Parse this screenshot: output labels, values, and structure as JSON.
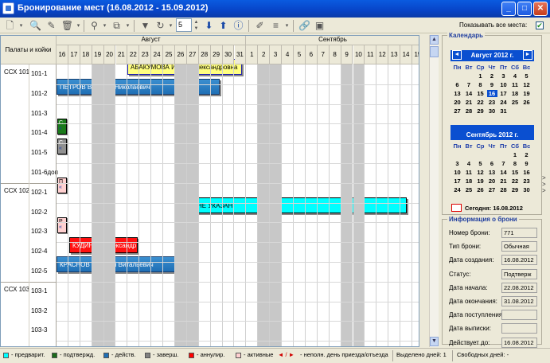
{
  "window": {
    "title": "Бронирование мест (16.08.2012 - 15.09.2012)"
  },
  "toolbar": {
    "spin_value": "5",
    "show_all_label": "Показывать все места:",
    "show_all_checked": true
  },
  "grid": {
    "header_left": "Палаты и койки",
    "months": [
      "Август",
      "Сентябрь"
    ],
    "days": [
      "16",
      "17",
      "18",
      "19",
      "20",
      "21",
      "22",
      "23",
      "24",
      "25",
      "26",
      "27",
      "28",
      "29",
      "30",
      "31",
      "1",
      "2",
      "3",
      "4",
      "5",
      "6",
      "7",
      "8",
      "9",
      "10",
      "11",
      "12",
      "13",
      "14",
      "15"
    ],
    "rooms": [
      {
        "name": "ССХ 101",
        "beds": [
          "101-1",
          "101-2",
          "101-3",
          "101-4",
          "101-5",
          "101-6доп"
        ]
      },
      {
        "name": "ССХ 102",
        "beds": [
          "102-1",
          "102-2",
          "102-3",
          "102-4",
          "102-5"
        ]
      },
      {
        "name": "ССХ 103",
        "beds": [
          "103-1",
          "103-2",
          "103-3",
          "103-4"
        ]
      }
    ],
    "bookings": [
      {
        "label": "АБАКУМОВА Ирина Александровна"
      },
      {
        "label": "ПЕТРОВ Василий Николаевич"
      },
      {
        "label": "НЕ УКАЗАН"
      },
      {
        "label": "КУДИНОВ Александр"
      },
      {
        "label": "КРАСНОВ Виталий Витальевич"
      }
    ],
    "small_marks": [
      "С",
      "С",
      "П",
      "Р"
    ],
    "arrow_glyph": "«"
  },
  "calendar": {
    "title": "Календарь",
    "month1": "Август 2012 г.",
    "month2": "Сентябрь 2012 г.",
    "weekdays": [
      "Пн",
      "Вт",
      "Ср",
      "Чт",
      "Пт",
      "Сб",
      "Вс"
    ],
    "aug_weeks": [
      [
        "",
        "",
        "1",
        "2",
        "3",
        "4",
        "5"
      ],
      [
        "6",
        "7",
        "8",
        "9",
        "10",
        "11",
        "12"
      ],
      [
        "13",
        "14",
        "15",
        "16",
        "17",
        "18",
        "19"
      ],
      [
        "20",
        "21",
        "22",
        "23",
        "24",
        "25",
        "26"
      ],
      [
        "27",
        "28",
        "29",
        "30",
        "31",
        "",
        ""
      ]
    ],
    "sep_weeks": [
      [
        "",
        "",
        "",
        "",
        "",
        "1",
        "2"
      ],
      [
        "3",
        "4",
        "5",
        "6",
        "7",
        "8",
        "9"
      ],
      [
        "10",
        "11",
        "12",
        "13",
        "14",
        "15",
        "16"
      ],
      [
        "17",
        "18",
        "19",
        "20",
        "21",
        "22",
        "23"
      ],
      [
        "24",
        "25",
        "26",
        "27",
        "28",
        "29",
        "30"
      ]
    ],
    "today_label": "Сегодня: 16.08.2012",
    "prev": "◄",
    "next": "►"
  },
  "info": {
    "title": "Информация о брони",
    "fields": [
      {
        "label": "Номер брони:",
        "value": "771"
      },
      {
        "label": "Тип брони:",
        "value": "Обычная"
      },
      {
        "label": "Дата создания:",
        "value": "16.08.2012"
      },
      {
        "label": "Статус:",
        "value": "Подтверж"
      },
      {
        "label": "Дата начала:",
        "value": "22.08.2012"
      },
      {
        "label": "Дата окончания:",
        "value": "31.08.2012"
      },
      {
        "label": "Дата поступления:",
        "value": ""
      },
      {
        "label": "Дата выписки:",
        "value": ""
      },
      {
        "label": "Действует до:",
        "value": "16.08.2012"
      }
    ]
  },
  "status": {
    "legend": [
      {
        "label": "- предварит.",
        "color": "#00ffff"
      },
      {
        "label": "- подтвержд.",
        "color": "#1a6b1a"
      },
      {
        "label": "- действ.",
        "color": "#1f6fb5"
      },
      {
        "label": "- заверш.",
        "color": "#808080"
      },
      {
        "label": "- аннулир.",
        "color": "#ff0000"
      },
      {
        "label": "- активные",
        "color": "#ffd0d0"
      },
      {
        "label": "- неполн. день приезда/отъезда",
        "color": ""
      }
    ],
    "selected_days": "Выделено дней: 1",
    "free_days": "Свободных дней: -"
  }
}
